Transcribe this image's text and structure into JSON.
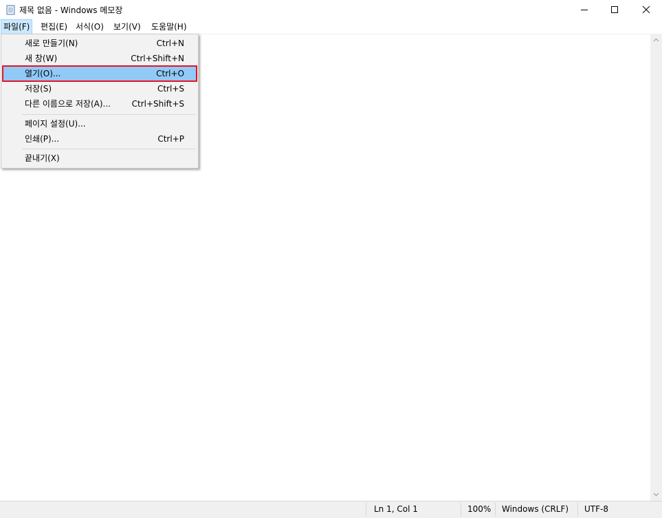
{
  "window": {
    "title": "제목 없음 - Windows 메모장",
    "icon": "notepad-icon"
  },
  "menubar": {
    "items": [
      {
        "label": "파일(F)"
      },
      {
        "label": "편집(E)"
      },
      {
        "label": "서식(O)"
      },
      {
        "label": "보기(V)"
      },
      {
        "label": "도움말(H)"
      }
    ]
  },
  "file_menu": {
    "items": [
      {
        "label": "새로 만들기(N)",
        "shortcut": "Ctrl+N"
      },
      {
        "label": "새 창(W)",
        "shortcut": "Ctrl+Shift+N"
      },
      {
        "label": "열기(O)...",
        "shortcut": "Ctrl+O",
        "highlighted": true
      },
      {
        "label": "저장(S)",
        "shortcut": "Ctrl+S"
      },
      {
        "label": "다른 이름으로 저장(A)...",
        "shortcut": "Ctrl+Shift+S"
      },
      {
        "label": "페이지 설정(U)...",
        "shortcut": ""
      },
      {
        "label": "인쇄(P)...",
        "shortcut": "Ctrl+P"
      },
      {
        "label": "끝내기(X)",
        "shortcut": ""
      }
    ]
  },
  "statusbar": {
    "position": "Ln 1, Col 1",
    "zoom": "100%",
    "line_ending": "Windows (CRLF)",
    "encoding": "UTF-8"
  },
  "colors": {
    "highlight_bg": "#91c9f7",
    "highlight_border": "#e81123",
    "menu_active_bg": "#cce8ff"
  }
}
